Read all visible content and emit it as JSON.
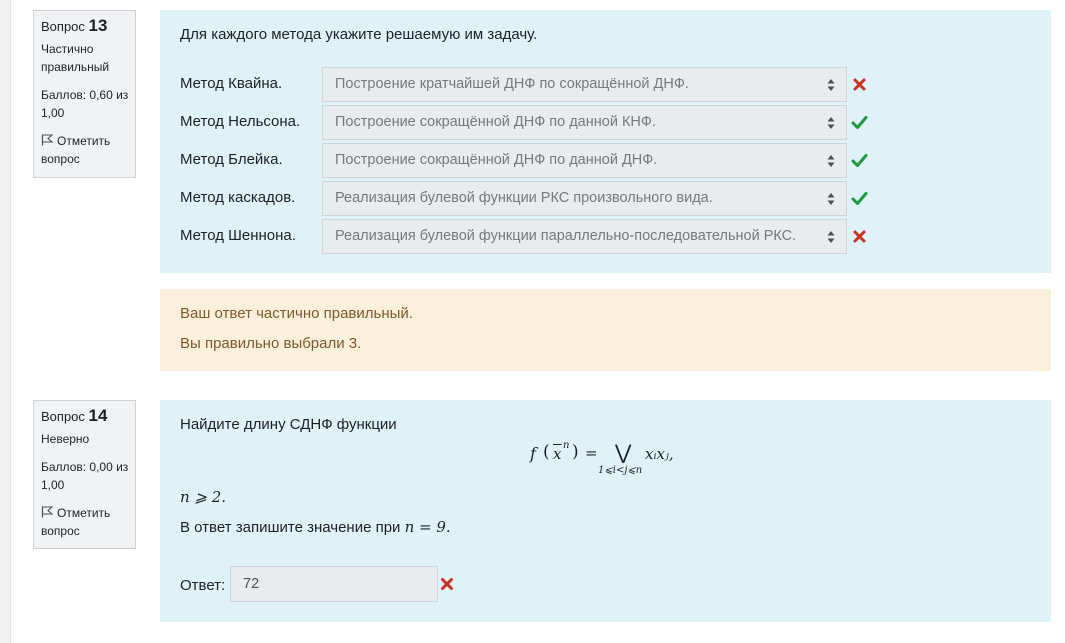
{
  "q13": {
    "label": "Вопрос",
    "number": "13",
    "state": "Частично правильный",
    "grade": "Баллов: 0,60 из 1,00",
    "flag_label": "Отметить вопрос",
    "question_text": "Для каждого метода укажите решаемую им задачу.",
    "rows": [
      {
        "label": "Метод Квайна.",
        "selected": "Построение кратчайшей ДНФ по сокращённой ДНФ.",
        "mark": "incorrect"
      },
      {
        "label": "Метод Нельсона.",
        "selected": "Построение сокращённой ДНФ по данной КНФ.",
        "mark": "correct"
      },
      {
        "label": "Метод Блейка.",
        "selected": "Построение сокращённой ДНФ по данной ДНФ.",
        "mark": "correct"
      },
      {
        "label": "Метод каскадов.",
        "selected": "Реализация булевой функции РКС произвольного вида.",
        "mark": "correct"
      },
      {
        "label": "Метод Шеннона.",
        "selected": "Реализация булевой функции параллельно-последовательной РКС.",
        "mark": "incorrect"
      }
    ],
    "feedback_line1": "Ваш ответ частично правильный.",
    "feedback_line2": "Вы правильно выбрали 3."
  },
  "q14": {
    "label": "Вопрос",
    "number": "14",
    "state": "Неверно",
    "grade": "Баллов: 0,00 из 1,00",
    "flag_label": "Отметить вопрос",
    "question_text": "Найдите длину СДНФ функции",
    "formula": {
      "lhs": "f",
      "var": "x",
      "superscript": "n",
      "equals": "=",
      "operator": "⋁",
      "subscript": "1⩽i<j⩽n",
      "term": "xᵢxⱼ,"
    },
    "condition": "n ⩾ 2.",
    "instruction_prefix": "В ответ запишите значение при",
    "instruction_math": "n = 9.",
    "answer_label": "Ответ:",
    "answer_value": "72",
    "answer_mark": "incorrect"
  },
  "colors": {
    "correct": "#1e9a3d",
    "incorrect": "#ca3120",
    "question_bg": "#def2f8",
    "feedback_bg": "#fcefdc"
  }
}
